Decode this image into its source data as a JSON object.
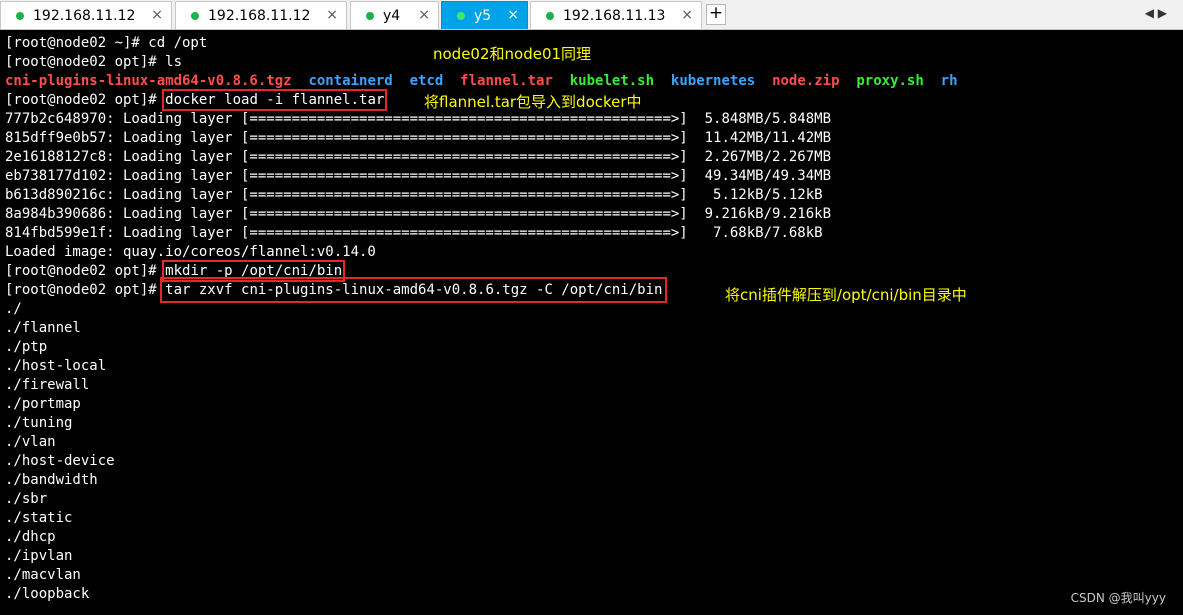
{
  "tabs": [
    {
      "label": "192.168.11.12",
      "active": false
    },
    {
      "label": "192.168.11.12",
      "active": false
    },
    {
      "label": "y4",
      "active": false
    },
    {
      "label": "y5",
      "active": true
    },
    {
      "label": "192.168.11.13",
      "active": false
    }
  ],
  "add_tab_label": "+",
  "tab_menu_label": "◀ ▶",
  "terminal": {
    "cmd_cd": "[root@node02 ~]# cd /opt",
    "cmd_ls": "[root@node02 opt]# ls",
    "ls_items": [
      {
        "name": "cni-plugins-linux-amd64-v0.8.6.tgz",
        "color": "red"
      },
      {
        "name": "containerd",
        "color": "blue"
      },
      {
        "name": "etcd",
        "color": "blue"
      },
      {
        "name": "flannel.tar",
        "color": "red"
      },
      {
        "name": "kubelet.sh",
        "color": "green"
      },
      {
        "name": "kubernetes",
        "color": "blue"
      },
      {
        "name": "node.zip",
        "color": "red"
      },
      {
        "name": "proxy.sh",
        "color": "green"
      },
      {
        "name": "rh",
        "color": "blue"
      }
    ],
    "prompt_opt": "[root@node02 opt]# ",
    "cmd_docker_load": "docker load -i flannel.tar",
    "layers": [
      "777b2c648970: Loading layer [==================================================>]  5.848MB/5.848MB",
      "815dff9e0b57: Loading layer [==================================================>]  11.42MB/11.42MB",
      "2e16188127c8: Loading layer [==================================================>]  2.267MB/2.267MB",
      "eb738177d102: Loading layer [==================================================>]  49.34MB/49.34MB",
      "b613d890216c: Loading layer [==================================================>]   5.12kB/5.12kB",
      "8a984b390686: Loading layer [==================================================>]  9.216kB/9.216kB",
      "814fbd599e1f: Loading layer [==================================================>]   7.68kB/7.68kB"
    ],
    "loaded_image": "Loaded image: quay.io/coreos/flannel:v0.14.0",
    "cmd_mkdir": "mkdir -p /opt/cni/bin",
    "cmd_tar": "tar zxvf cni-plugins-linux-amd64-v0.8.6.tgz -C /opt/cni/bin",
    "extracted": [
      "./",
      "./flannel",
      "./ptp",
      "./host-local",
      "./firewall",
      "./portmap",
      "./tuning",
      "./vlan",
      "./host-device",
      "./bandwidth",
      "./sbr",
      "./static",
      "./dhcp",
      "./ipvlan",
      "./macvlan",
      "./loopback"
    ]
  },
  "annotations": {
    "same_as_node01": "node02和node01同理",
    "docker_load_note": "将flannel.tar包导入到docker中",
    "tar_note": "将cni插件解压到/opt/cni/bin目录中"
  },
  "watermark": "CSDN @我叫yyy",
  "colors": {
    "ls_red": "#ff4d4d",
    "ls_blue": "#3aa4ff",
    "ls_green": "#33ee33",
    "annotation": "#ffff00",
    "highlight_box": "#e8262a",
    "active_tab": "#00a2e8"
  }
}
